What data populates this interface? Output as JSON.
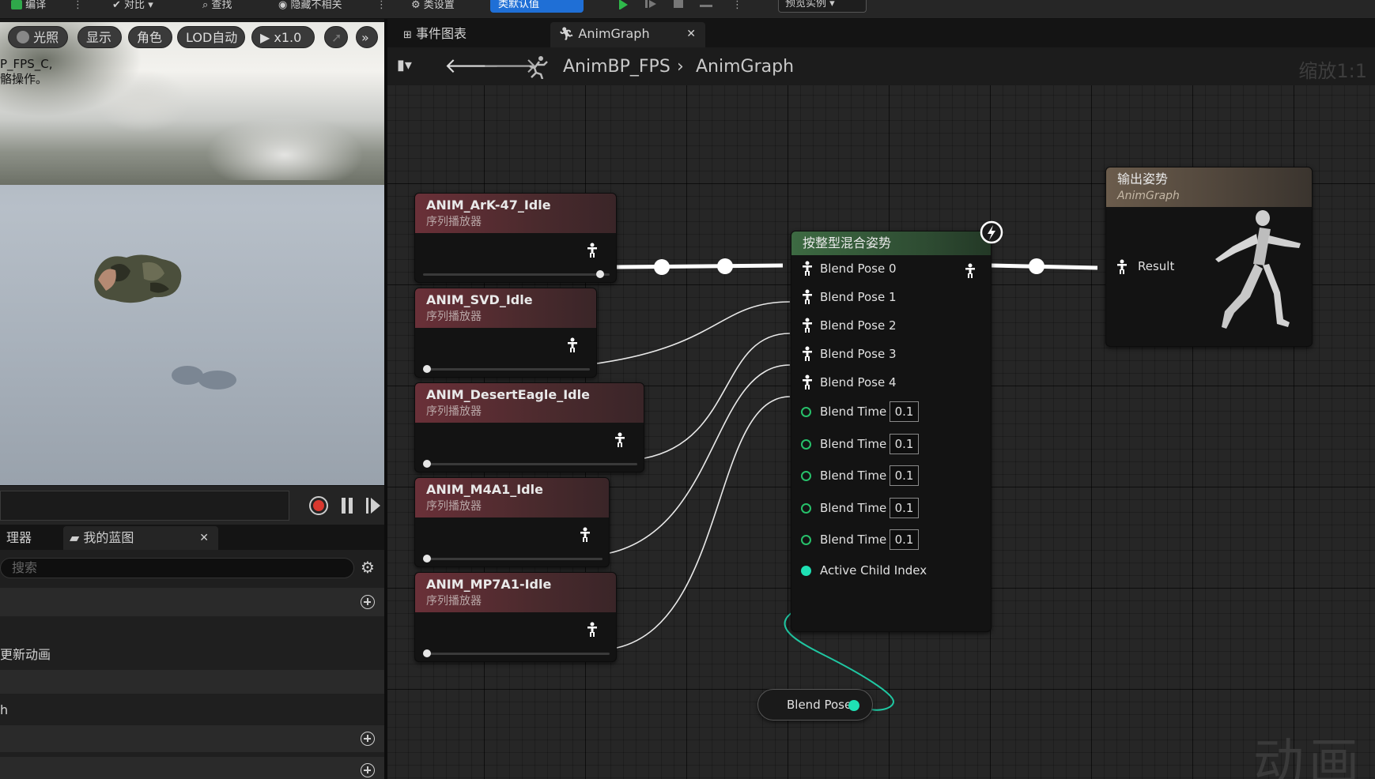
{
  "toolbar": {
    "compile_label": "编译",
    "diff_label": "对比",
    "find_label": "查找",
    "hide_unrelated_label": "隐藏不相关",
    "class_settings_label": "类设置",
    "class_defaults_label": "类默认值",
    "preview_instance_label": "预览实例"
  },
  "viewport": {
    "lighting_label": "光照",
    "show_label": "显示",
    "character_label": "角色",
    "lod_label": "LOD自动",
    "speed_label": "x1.0",
    "overlay_line1": "P_FPS_C,",
    "overlay_line2": "骼操作。"
  },
  "left_panel": {
    "tab1_label": "理器",
    "tab2_label": "我的蓝图",
    "search_placeholder": "搜索",
    "row1_label": "更新动画",
    "row2_label": "h"
  },
  "graph_tabs": {
    "event_graph_label": "事件图表",
    "anim_graph_label": "AnimGraph"
  },
  "graph_header": {
    "breadcrumb_root": "AnimBP_FPS",
    "breadcrumb_current": "AnimGraph",
    "zoom_label": "缩放1:1"
  },
  "watermark": "动画",
  "seq_nodes": [
    {
      "title": "ANIM_ArK-47_Idle",
      "subtitle": "序列播放器",
      "progress": 0.97
    },
    {
      "title": "ANIM_SVD_Idle",
      "subtitle": "序列播放器",
      "progress": 0.0
    },
    {
      "title": "ANIM_DesertEagle_Idle",
      "subtitle": "序列播放器",
      "progress": 0.0
    },
    {
      "title": "ANIM_M4A1_Idle",
      "subtitle": "序列播放器",
      "progress": 0.0
    },
    {
      "title": "ANIM_MP7A1-Idle",
      "subtitle": "序列播放器",
      "progress": 0.0
    }
  ],
  "blend_node": {
    "title": "按整型混合姿势",
    "poses": [
      "Blend Pose 0",
      "Blend Pose 1",
      "Blend Pose 2",
      "Blend Pose 3",
      "Blend Pose 4"
    ],
    "times": [
      {
        "label": "Blend Time 0",
        "value": "0.1"
      },
      {
        "label": "Blend Time 1",
        "value": "0.1"
      },
      {
        "label": "Blend Time 2",
        "value": "0.1"
      },
      {
        "label": "Blend Time 3",
        "value": "0.1"
      },
      {
        "label": "Blend Time 4",
        "value": "0.1"
      }
    ],
    "active_child_label": "Active Child Index"
  },
  "output_node": {
    "title": "输出姿势",
    "subtitle": "AnimGraph",
    "result_label": "Result"
  },
  "variable_node": {
    "label": "Blend Pose"
  },
  "colors": {
    "accent_blue": "#1f6fd6",
    "float_pin": "#27c06a",
    "int_pin": "#1fe0b4",
    "exec_wire": "#ffffff"
  }
}
